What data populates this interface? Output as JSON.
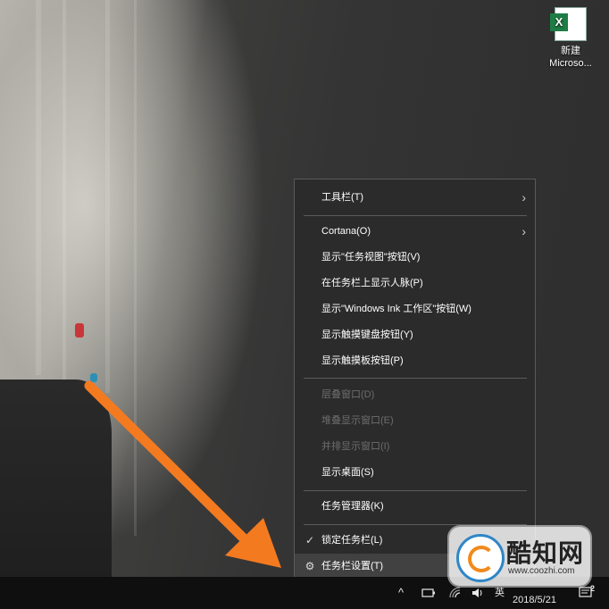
{
  "desktop": {
    "icon": {
      "icon": "excel-file-icon",
      "glyph": "X",
      "label_line1": "新建",
      "label_line2": "Microso..."
    }
  },
  "menu": {
    "items": [
      {
        "label": "工具栏(T)",
        "disabled": false,
        "submenu": true
      },
      {
        "label": "Cortana(O)",
        "disabled": false,
        "submenu": true
      },
      {
        "label": "显示\"任务视图\"按钮(V)",
        "disabled": false
      },
      {
        "label": "在任务栏上显示人脉(P)",
        "disabled": false
      },
      {
        "label": "显示\"Windows Ink 工作区\"按钮(W)",
        "disabled": false
      },
      {
        "label": "显示触摸键盘按钮(Y)",
        "disabled": false
      },
      {
        "label": "显示触摸板按钮(P)",
        "disabled": false
      },
      {
        "label": "层叠窗口(D)",
        "disabled": true
      },
      {
        "label": "堆叠显示窗口(E)",
        "disabled": true
      },
      {
        "label": "并排显示窗口(I)",
        "disabled": true
      },
      {
        "label": "显示桌面(S)",
        "disabled": false
      },
      {
        "label": "任务管理器(K)",
        "disabled": false
      },
      {
        "label": "锁定任务栏(L)",
        "disabled": false,
        "checked": true
      },
      {
        "label": "任务栏设置(T)",
        "disabled": false,
        "icon": "gear-icon"
      }
    ],
    "chevron": "›",
    "check": "✓",
    "gear": "⚙"
  },
  "taskbar": {
    "chevron_up": "^",
    "ime": "英",
    "date": "2018/5/21",
    "notification_count": "2"
  },
  "watermark": {
    "brand": "酷知网",
    "url": "www.coozhi.com"
  },
  "colors": {
    "arrow": "#f47a20",
    "menu_bg": "#2b2b2b",
    "taskbar_bg": "#0f0f0f"
  }
}
